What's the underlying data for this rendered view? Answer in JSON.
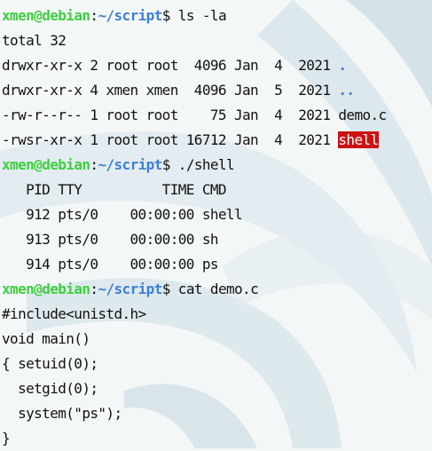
{
  "prompt": {
    "user": "xmen",
    "at": "@",
    "host": "debian",
    "sep": ":",
    "path": "~/script",
    "symbol": "$"
  },
  "commands": {
    "ls": " ls -la",
    "run": " ./shell",
    "cat": " cat demo.c"
  },
  "ls_output": {
    "total": "total 32",
    "rows": [
      {
        "meta": "drwxr-xr-x 2 root root  4096 Jan  4  2021 ",
        "name": "."
      },
      {
        "meta": "drwxr-xr-x 4 xmen xmen  4096 Jan  5  2021 ",
        "name": ".."
      },
      {
        "meta": "-rw-r--r-- 1 root root    75 Jan  4  2021 ",
        "name": "demo.c"
      },
      {
        "meta": "-rwsr-xr-x 1 root root 16712 Jan  4  2021 ",
        "name": "shell"
      }
    ]
  },
  "ps_output": {
    "header": "   PID TTY          TIME CMD",
    "rows": [
      "   912 pts/0    00:00:00 shell",
      "   913 pts/0    00:00:00 sh",
      "   914 pts/0    00:00:00 ps"
    ]
  },
  "demo_c": [
    "#include<unistd.h>",
    "void main()",
    "{ setuid(0);",
    "  setgid(0);",
    "  system(\"ps\");",
    "}"
  ],
  "colors": {
    "user_host": "#3ecf3e",
    "path": "#3d7fd6",
    "directory": "#3d7fd6",
    "setuid_highlight": "#cc1111",
    "text": "#111111",
    "background": "#f4f7f8"
  }
}
